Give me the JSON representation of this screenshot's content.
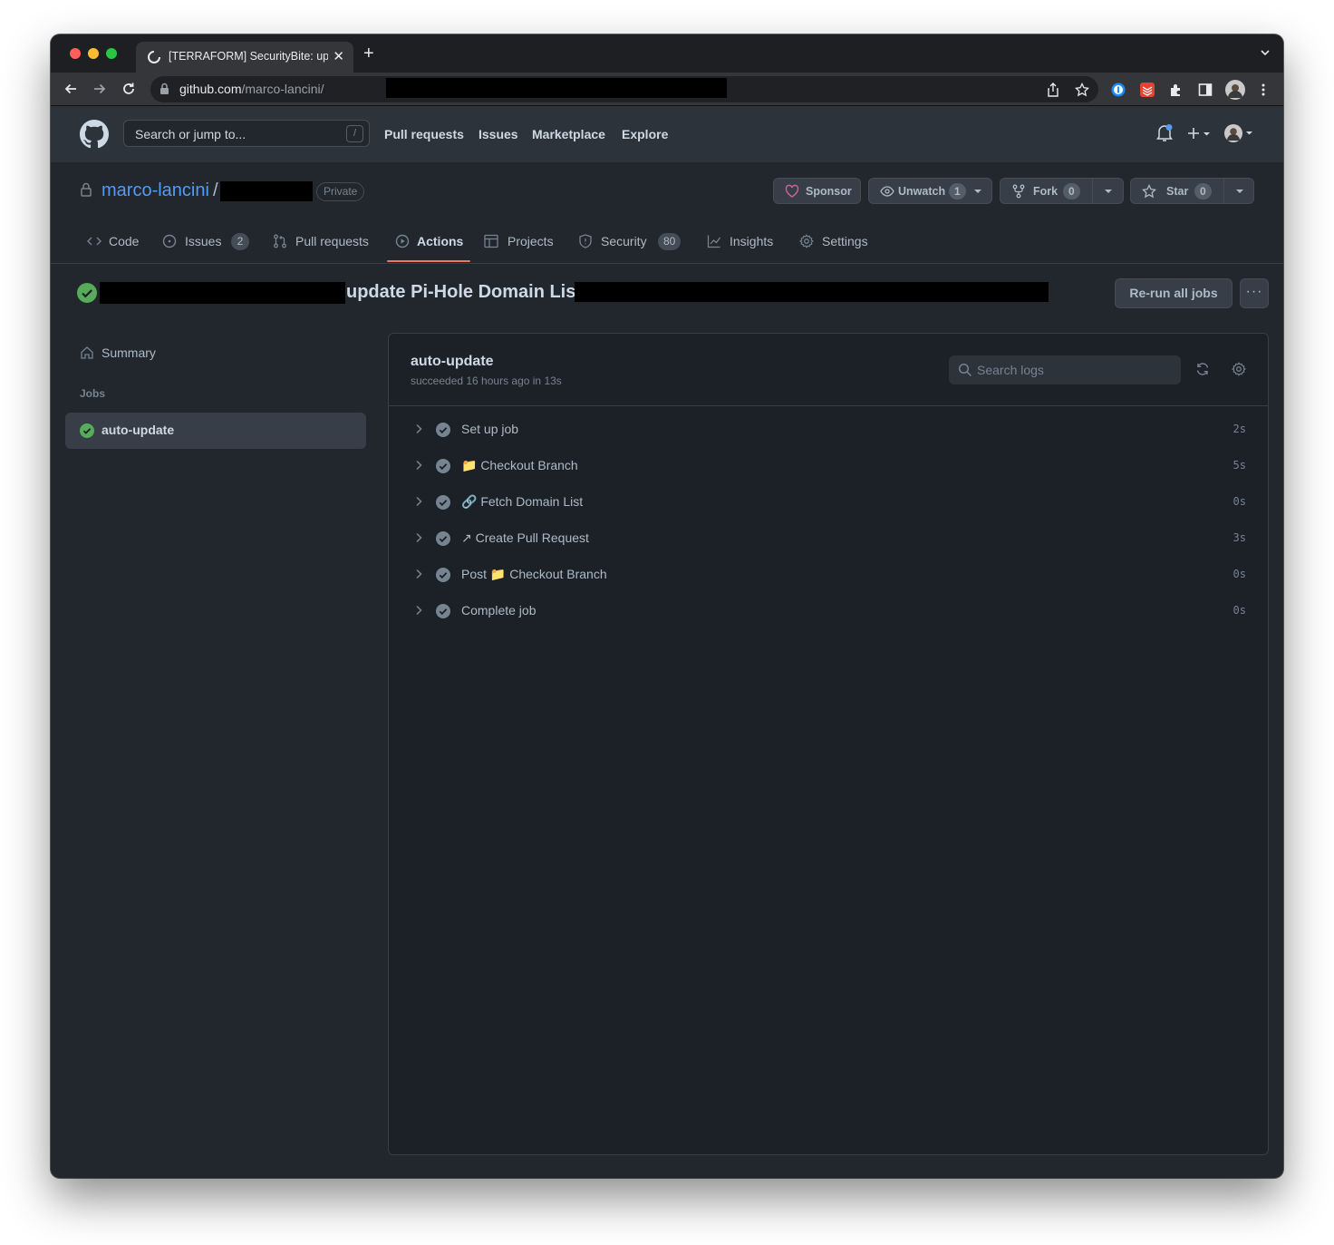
{
  "browser": {
    "tab_title": "[TERRAFORM] SecurityBite: up",
    "tab_close": "✕",
    "new_tab": "+",
    "url_host": "github.com",
    "url_path": "/marco-lancini/"
  },
  "gh_header": {
    "search_placeholder": "Search or jump to...",
    "search_shortcut": "/",
    "nav": [
      "Pull requests",
      "Issues",
      "Marketplace",
      "Explore"
    ]
  },
  "repo": {
    "owner": "marco-lancini",
    "separator": "/",
    "visibility": "Private",
    "sponsor_label": "Sponsor",
    "watch_label": "Unwatch",
    "watch_count": "1",
    "fork_label": "Fork",
    "fork_count": "0",
    "star_label": "Star",
    "star_count": "0",
    "tabs": [
      {
        "label": "Code",
        "icon": "code-icon"
      },
      {
        "label": "Issues",
        "count": "2",
        "icon": "issue-icon"
      },
      {
        "label": "Pull requests",
        "icon": "pull-request-icon"
      },
      {
        "label": "Actions",
        "icon": "play-icon",
        "active": true
      },
      {
        "label": "Projects",
        "icon": "table-icon"
      },
      {
        "label": "Security",
        "count": "80",
        "icon": "shield-icon"
      },
      {
        "label": "Insights",
        "icon": "graph-icon"
      },
      {
        "label": "Settings",
        "icon": "gear-icon"
      }
    ]
  },
  "run": {
    "title": "update Pi-Hole Domain List",
    "rerun_label": "Re-run all jobs",
    "more_label": "···"
  },
  "sidebar": {
    "summary_label": "Summary",
    "jobs_header": "Jobs",
    "job_label": "auto-update"
  },
  "job": {
    "title": "auto-update",
    "subtitle": "succeeded 16 hours ago in 13s",
    "search_placeholder": "Search logs",
    "steps": [
      {
        "name": "Set up job",
        "duration": "2s"
      },
      {
        "name": "📁 Checkout Branch",
        "duration": "5s"
      },
      {
        "name": "🔗 Fetch Domain List",
        "duration": "0s"
      },
      {
        "name": "↗ Create Pull Request",
        "duration": "3s"
      },
      {
        "name": "Post 📁 Checkout Branch",
        "duration": "0s"
      },
      {
        "name": "Complete job",
        "duration": "0s"
      }
    ]
  },
  "colors": {
    "success": "#57ab5a",
    "accent_link": "#539bf5",
    "tab_underline": "#ec775c",
    "sponsor_heart": "#c96198"
  }
}
